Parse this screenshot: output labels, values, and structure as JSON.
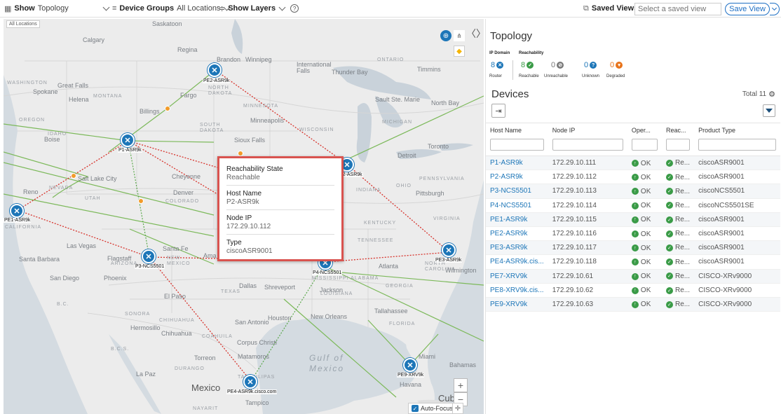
{
  "toolbar": {
    "show_label": "Show",
    "show_value": "Topology",
    "device_groups_label": "Device Groups",
    "device_groups_value": "All Locations",
    "show_layers_label": "Show Layers",
    "saved_views_label": "Saved Views",
    "saved_view_placeholder": "Select a saved view",
    "save_view_label": "Save View"
  },
  "map": {
    "scope_label": "All Locations",
    "places": {
      "saskatoon": "Saskatoon",
      "calgary": "Calgary",
      "regina": "Regina",
      "brandon": "Brandon",
      "winnipeg": "Winnipeg",
      "ontario": "ONTARIO",
      "international_falls": "International\nFalls",
      "thunder_bay": "Thunder Bay",
      "timmins": "Timmins",
      "washington": "WASHINGTON",
      "great_falls": "Great Falls",
      "spokane": "Spokane",
      "helena": "Helena",
      "montana": "MONTANA",
      "north_dakota": "NORTH\nDAKOTA",
      "fargo": "Fargo",
      "sault": "Sault Ste. Marie",
      "north_bay": "North Bay",
      "billings": "Billings",
      "minnesota": "MINNESOTA",
      "minneapolis": "Minneapolis",
      "oregon": "OREGON",
      "idaho": "IDAHO",
      "boise": "Boise",
      "south_dakota": "SOUTH\nDAKOTA",
      "sioux_falls": "Sioux Falls",
      "wisconsin": "WISCONSIN",
      "michigan": "MICHIGAN",
      "toronto": "Toronto",
      "detroit": "Detroit",
      "salt_lake": "Salt Lake City",
      "nevada": "NEVADA",
      "reno": "Reno",
      "cheyenne": "Cheyenne",
      "utah": "UTAH",
      "denver": "Denver",
      "colorado": "COLORADO",
      "pennsylvania": "PENNSYLVANIA",
      "pittsburgh": "Pittsburgh",
      "ohio": "OHIO",
      "indiana": "INDIANA",
      "california": "CALIFORNIA",
      "kentucky": "KENTUCKY",
      "virginia": "VIRGINIA",
      "las_vegas": "Las Vegas",
      "tennessee": "TENNESSEE",
      "santa_fe": "Santa Fe",
      "santa_barbara": "Santa Barbara",
      "flagstaff": "Flagstaff",
      "arizona": "ARIZONA",
      "new_mexico": "NEW\nMEXICO",
      "north_carolina": "NORTH\nCAROLINA",
      "atlanta": "Atlanta",
      "wilmington": "Wilmington",
      "san_diego": "San Diego",
      "phoenix": "Phoenix",
      "mississippi_alabama": "MISSISSIPPI ALABAMA",
      "georgia": "GEORGIA",
      "dallas": "Dallas",
      "shreveport": "Shreveport",
      "jackson": "Jackson",
      "texas": "TEXAS",
      "el_paso": "El Paso",
      "louisiana": "LOUISIANA",
      "tallahassee": "Tallahassee",
      "bc": "B.C.",
      "sonora": "SONORA",
      "chihuahua_state": "CHIHUAHUA",
      "hermosillo": "Hermosillo",
      "chihuahua": "Chihuahua",
      "san_antonio": "San Antonio",
      "houston": "Houston",
      "new_orleans": "New Orleans",
      "florida": "FLORIDA",
      "coahuila": "COAHUILA",
      "corpus_christi": "Corpus Christi",
      "torreon": "Torreon",
      "matamoros": "Matamoros",
      "miami": "Miami",
      "bahamas": "Bahamas",
      "gulf": "Gulf of\nMexico",
      "la_paz": "La Paz",
      "durango": "DURANGO",
      "mexico": "Mexico",
      "tamaulipas": "TAMAULIPAS",
      "havana": "Havana",
      "cuba": "Cuba",
      "tampico": "Tampico",
      "bc_sur": "B.C.S.",
      "nayarit": "NAYARIT",
      "amarillo": "Ama"
    },
    "nodes": [
      {
        "id": "pe2",
        "label": "PE2-ASR9k"
      },
      {
        "id": "p1",
        "label": "P1-ASR9k"
      },
      {
        "id": "p2",
        "label": "P2-ASR9k"
      },
      {
        "id": "pe1",
        "label": "PE1-ASR9k"
      },
      {
        "id": "p3",
        "label": "P3-NCS5501"
      },
      {
        "id": "p4",
        "label": "P4-NCS5501"
      },
      {
        "id": "pe3",
        "label": "PE3-ASR9k"
      },
      {
        "id": "pe9",
        "label": "PE9-XRV9k"
      },
      {
        "id": "pe4",
        "label": "PE4-ASR9k.cisco.com"
      }
    ],
    "auto_focus_label": "Auto-Focus",
    "zoom_in": "+",
    "zoom_out": "−"
  },
  "tooltip": {
    "reach_label": "Reachability State",
    "reach_value": "Reachable",
    "host_label": "Host Name",
    "host_value": "P2-ASR9k",
    "ip_label": "Node IP",
    "ip_value": "172.29.10.112",
    "type_label": "Type",
    "type_value": "ciscoASR9001"
  },
  "panel": {
    "title": "Topology",
    "ip_domain_label": "IP Domain",
    "reachability_label": "Reachability",
    "stats": [
      {
        "count": "8",
        "label": "Router",
        "color": "#1d76b8"
      },
      {
        "count": "8",
        "label": "Reachable",
        "color": "#3a9b47"
      },
      {
        "count": "0",
        "label": "Unreachable",
        "color": "#777777"
      },
      {
        "count": "0",
        "label": "Unknown",
        "color": "#1d76b8"
      },
      {
        "count": "0",
        "label": "Degraded",
        "color": "#e8731a"
      }
    ],
    "devices_title": "Devices",
    "total_label": "Total 11",
    "columns": [
      "Host Name",
      "Node IP",
      "Oper...",
      "Reac...",
      "Product Type"
    ],
    "rows": [
      {
        "host": "P1-ASR9k",
        "ip": "172.29.10.111",
        "oper": "OK",
        "reach": "Re...",
        "type": "ciscoASR9001"
      },
      {
        "host": "P2-ASR9k",
        "ip": "172.29.10.112",
        "oper": "OK",
        "reach": "Re...",
        "type": "ciscoASR9001"
      },
      {
        "host": "P3-NCS5501",
        "ip": "172.29.10.113",
        "oper": "OK",
        "reach": "Re...",
        "type": "ciscoNCS5501"
      },
      {
        "host": "P4-NCS5501",
        "ip": "172.29.10.114",
        "oper": "OK",
        "reach": "Re...",
        "type": "ciscoNCS5501SE"
      },
      {
        "host": "PE1-ASR9k",
        "ip": "172.29.10.115",
        "oper": "OK",
        "reach": "Re...",
        "type": "ciscoASR9001"
      },
      {
        "host": "PE2-ASR9k",
        "ip": "172.29.10.116",
        "oper": "OK",
        "reach": "Re...",
        "type": "ciscoASR9001"
      },
      {
        "host": "PE3-ASR9k",
        "ip": "172.29.10.117",
        "oper": "OK",
        "reach": "Re...",
        "type": "ciscoASR9001"
      },
      {
        "host": "PE4-ASR9k.cis...",
        "ip": "172.29.10.118",
        "oper": "OK",
        "reach": "Re...",
        "type": "ciscoASR9001"
      },
      {
        "host": "PE7-XRV9k",
        "ip": "172.29.10.61",
        "oper": "OK",
        "reach": "Re...",
        "type": "CISCO-XRv9000"
      },
      {
        "host": "PE8-XRV9k.cis...",
        "ip": "172.29.10.62",
        "oper": "OK",
        "reach": "Re...",
        "type": "CISCO-XRv9000"
      },
      {
        "host": "PE9-XRV9k",
        "ip": "172.29.10.63",
        "oper": "OK",
        "reach": "Re...",
        "type": "CISCO-XRv9000"
      }
    ]
  }
}
